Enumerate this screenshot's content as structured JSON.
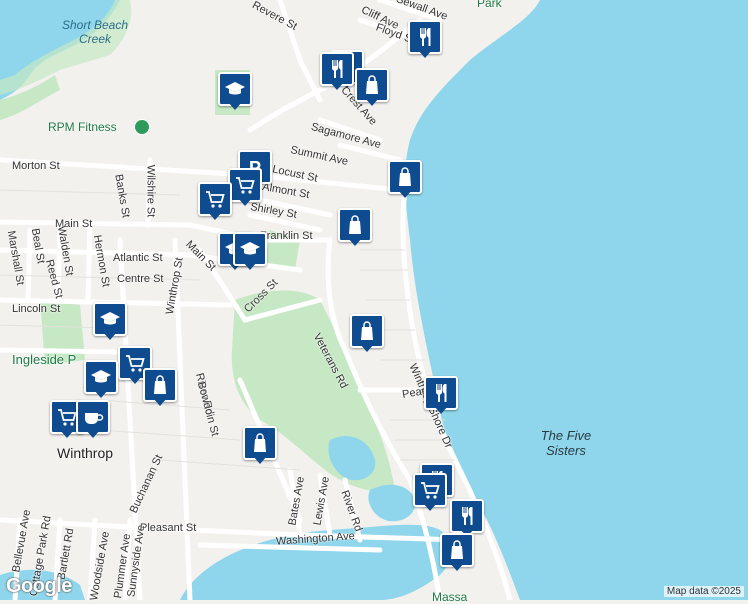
{
  "map": {
    "streets": [
      {
        "id": "revere",
        "label": "Revere St"
      },
      {
        "id": "sewall",
        "label": "Sewall Ave"
      },
      {
        "id": "cliff",
        "label": "Cliff Ave"
      },
      {
        "id": "floyd",
        "label": "Floyd St"
      },
      {
        "id": "crest",
        "label": "Crest Ave"
      },
      {
        "id": "sagamore",
        "label": "Sagamore Ave"
      },
      {
        "id": "summit",
        "label": "Summit Ave"
      },
      {
        "id": "locust",
        "label": "Locust St"
      },
      {
        "id": "almont",
        "label": "Almont St"
      },
      {
        "id": "shirley",
        "label": "Shirley St"
      },
      {
        "id": "franklin",
        "label": "Franklin St"
      },
      {
        "id": "morton",
        "label": "Morton St"
      },
      {
        "id": "main",
        "label": "Main St"
      },
      {
        "id": "main2",
        "label": "Main St"
      },
      {
        "id": "wilshire",
        "label": "Wilshire St"
      },
      {
        "id": "banks",
        "label": "Banks St"
      },
      {
        "id": "atlantic",
        "label": "Atlantic St"
      },
      {
        "id": "centre",
        "label": "Centre St"
      },
      {
        "id": "lincoln",
        "label": "Lincoln St"
      },
      {
        "id": "marshall",
        "label": "Marshall St"
      },
      {
        "id": "beal",
        "label": "Beal St"
      },
      {
        "id": "walden",
        "label": "Walden St"
      },
      {
        "id": "hermon",
        "label": "Hermon St"
      },
      {
        "id": "reed",
        "label": "Reed St"
      },
      {
        "id": "winthrop",
        "label": "Winthrop St"
      },
      {
        "id": "cross",
        "label": "Cross St"
      },
      {
        "id": "veterans",
        "label": "Veterans Rd"
      },
      {
        "id": "winthropshore",
        "label": "Winthrop Shore Dr"
      },
      {
        "id": "pearl",
        "label": "Pearl Ave"
      },
      {
        "id": "riverrd",
        "label": "River Rd"
      },
      {
        "id": "bowdoin",
        "label": "Bowdoin St"
      },
      {
        "id": "buchanan",
        "label": "Buchanan St"
      },
      {
        "id": "bates",
        "label": "Bates Ave"
      },
      {
        "id": "lewis",
        "label": "Lewis Ave"
      },
      {
        "id": "riverrd2",
        "label": "River Rd"
      },
      {
        "id": "pleasant",
        "label": "Pleasant St"
      },
      {
        "id": "washington",
        "label": "Washington Ave"
      },
      {
        "id": "bellevue",
        "label": "Bellevue Ave"
      },
      {
        "id": "cottagepark",
        "label": "Cottage Park Rd"
      },
      {
        "id": "bartlett",
        "label": "Bartlett Rd"
      },
      {
        "id": "woodside",
        "label": "Woodside Ave"
      },
      {
        "id": "plummer",
        "label": "Plummer Ave"
      },
      {
        "id": "sunnyside",
        "label": "Sunnyside Ave"
      }
    ],
    "places": {
      "short_beach_creek": "Short Beach Creek",
      "rpm_fitness": "RPM Fitness",
      "ingleside": "Ingleside P",
      "winthrop": "Winthrop",
      "five_sisters": "The Five Sisters",
      "park": "Park",
      "massa": "Massa"
    },
    "markers": [
      {
        "type": "restaurant",
        "icon": "fork-knife-icon"
      },
      {
        "type": "restaurant",
        "icon": "fork-knife-icon"
      },
      {
        "type": "restaurant",
        "icon": "fork-knife-icon"
      },
      {
        "type": "shopping",
        "icon": "shopping-bag-icon"
      },
      {
        "type": "school",
        "icon": "graduation-cap-icon"
      },
      {
        "type": "shopping",
        "icon": "shopping-bag-icon"
      },
      {
        "type": "shopping",
        "icon": "shopping-bag-icon"
      },
      {
        "type": "parking",
        "icon": "parking-icon"
      },
      {
        "type": "grocery",
        "icon": "shopping-cart-icon"
      },
      {
        "type": "grocery",
        "icon": "shopping-cart-icon"
      },
      {
        "type": "school",
        "icon": "graduation-cap-icon"
      },
      {
        "type": "school",
        "icon": "graduation-cap-icon"
      },
      {
        "type": "shopping",
        "icon": "shopping-bag-icon"
      },
      {
        "type": "school",
        "icon": "graduation-cap-icon"
      },
      {
        "type": "grocery",
        "icon": "shopping-cart-icon"
      },
      {
        "type": "school",
        "icon": "graduation-cap-icon"
      },
      {
        "type": "shopping",
        "icon": "shopping-bag-icon"
      },
      {
        "type": "grocery",
        "icon": "shopping-cart-icon"
      },
      {
        "type": "cafe",
        "icon": "coffee-cup-icon"
      },
      {
        "type": "shopping",
        "icon": "shopping-bag-icon"
      },
      {
        "type": "restaurant",
        "icon": "fork-knife-icon"
      },
      {
        "type": "restaurant",
        "icon": "fork-knife-icon"
      },
      {
        "type": "grocery",
        "icon": "shopping-cart-icon"
      },
      {
        "type": "restaurant",
        "icon": "fork-knife-icon"
      },
      {
        "type": "shopping",
        "icon": "shopping-bag-icon"
      }
    ],
    "attribution": "Map data ©2025",
    "logo": "Google",
    "colors": {
      "water": "#8fd6ec",
      "land": "#f2f1ee",
      "park": "#c6e8c4",
      "road": "#ffffff",
      "marker": "#0f4c8f"
    }
  }
}
